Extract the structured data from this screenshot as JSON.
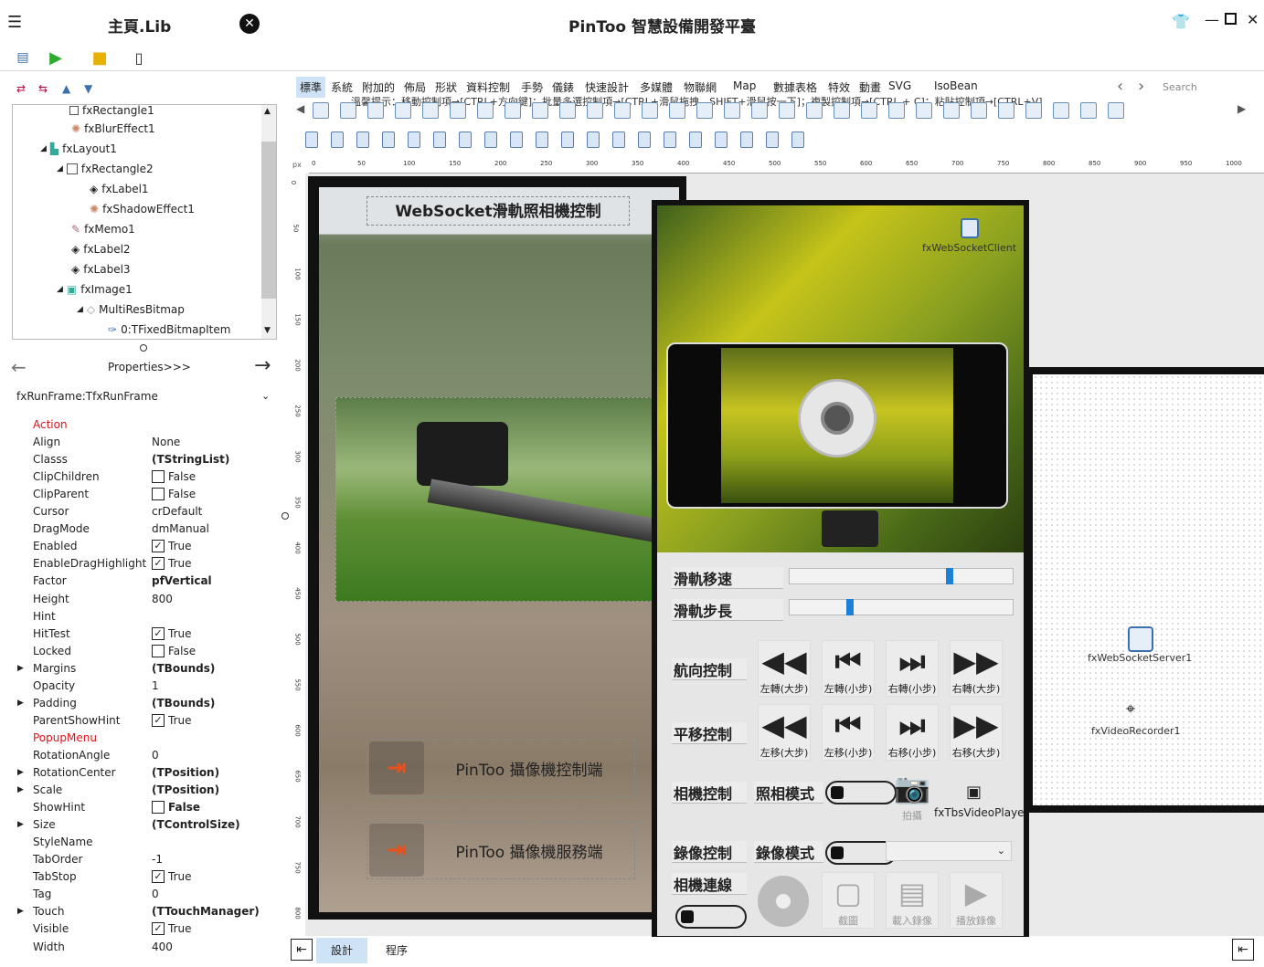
{
  "title": {
    "left": "主頁.Lib",
    "center": "PinToo 智慧設備開發平臺"
  },
  "hint": "溫馨提示：移動控制項→[CTRL+方向鍵]；批量多選控制項→[CTRL+滑鼠拖拽、SHIFT+滑鼠按一下]；複製控制項→[CTRL + C]；粘貼控制項→[CTRL+V]",
  "tree": [
    {
      "label": "fxRectangle1",
      "indent": 1
    },
    {
      "label": "fxBlurEffect1",
      "indent": 2
    },
    {
      "label": "fxLayout1",
      "indent": 1
    },
    {
      "label": "fxRectangle2",
      "indent": 2
    },
    {
      "label": "fxLabel1",
      "indent": 3
    },
    {
      "label": "fxShadowEffect1",
      "indent": 3
    },
    {
      "label": "fxMemo1",
      "indent": 2
    },
    {
      "label": "fxLabel2",
      "indent": 2
    },
    {
      "label": "fxLabel3",
      "indent": 2
    },
    {
      "label": "fxImage1",
      "indent": 2
    },
    {
      "label": "MultiResBitmap",
      "indent": 3
    },
    {
      "label": "0:TFixedBitmapItem",
      "indent": 4
    }
  ],
  "properties_label": "Properties>>>",
  "component_selector": "fxRunFrame:TfxRunFrame",
  "props": [
    {
      "name": "Action",
      "val": "",
      "red": true
    },
    {
      "name": "Align",
      "val": "None"
    },
    {
      "name": "Classs",
      "val": "(TStringList)",
      "bold": true
    },
    {
      "name": "ClipChildren",
      "val": "False",
      "chk": false
    },
    {
      "name": "ClipParent",
      "val": "False",
      "chk": false
    },
    {
      "name": "Cursor",
      "val": "crDefault"
    },
    {
      "name": "DragMode",
      "val": "dmManual"
    },
    {
      "name": "Enabled",
      "val": "True",
      "chk": true
    },
    {
      "name": "EnableDragHighlight",
      "val": "True",
      "chk": true
    },
    {
      "name": "Factor",
      "val": "pfVertical",
      "bold": true
    },
    {
      "name": "Height",
      "val": "800"
    },
    {
      "name": "Hint",
      "val": ""
    },
    {
      "name": "HitTest",
      "val": "True",
      "chk": true
    },
    {
      "name": "Locked",
      "val": "False",
      "chk": false
    },
    {
      "name": "Margins",
      "val": "(TBounds)",
      "bold": true,
      "expand": true
    },
    {
      "name": "Opacity",
      "val": "1"
    },
    {
      "name": "Padding",
      "val": "(TBounds)",
      "bold": true,
      "expand": true
    },
    {
      "name": "ParentShowHint",
      "val": "True",
      "chk": true
    },
    {
      "name": "PopupMenu",
      "val": "",
      "red": true
    },
    {
      "name": "RotationAngle",
      "val": "0"
    },
    {
      "name": "RotationCenter",
      "val": "(TPosition)",
      "bold": true,
      "expand": true
    },
    {
      "name": "Scale",
      "val": "(TPosition)",
      "bold": true,
      "expand": true
    },
    {
      "name": "ShowHint",
      "val": "False",
      "chk": false,
      "bold": true
    },
    {
      "name": "Size",
      "val": "(TControlSize)",
      "bold": true,
      "expand": true
    },
    {
      "name": "StyleName",
      "val": ""
    },
    {
      "name": "TabOrder",
      "val": "-1"
    },
    {
      "name": "TabStop",
      "val": "True",
      "chk": true
    },
    {
      "name": "Tag",
      "val": "0"
    },
    {
      "name": "Touch",
      "val": "(TTouchManager)",
      "bold": true,
      "expand": true
    },
    {
      "name": "Visible",
      "val": "True",
      "chk": true
    },
    {
      "name": "Width",
      "val": "400"
    }
  ],
  "tabs": [
    "標準",
    "系統",
    "附加的",
    "佈局",
    "形狀",
    "資料控制",
    "手勢",
    "儀錶",
    "快速設計",
    "多媒體",
    "物聯網",
    "Map",
    "數據表格",
    "特效",
    "動畫",
    "SVG",
    "IsoBean"
  ],
  "search_placeholder": "Search",
  "ruler_h": [
    "0",
    "50",
    "100",
    "150",
    "200",
    "250",
    "300",
    "350",
    "400",
    "450",
    "500",
    "550",
    "600",
    "650",
    "700",
    "750",
    "800",
    "850",
    "900",
    "950",
    "1000"
  ],
  "ruler_v": [
    "0",
    "50",
    "100",
    "150",
    "200",
    "250",
    "300",
    "350",
    "400",
    "450",
    "500",
    "550",
    "600",
    "650",
    "700",
    "750",
    "800"
  ],
  "ruler_unit": "px",
  "frame1": {
    "title": "WebSocket滑軌照相機控制",
    "btn1": "PinToo 攝像機控制端",
    "btn2": "PinToo 攝像機服務端"
  },
  "frame2": {
    "ws_client": "fxWebSocketClient",
    "speed": "滑軌移速",
    "step": "滑軌步長",
    "speed_value": 0.72,
    "step_value": 0.26,
    "heading": "航向控制",
    "pan": "平移控制",
    "heading_btns": [
      "左轉(大步)",
      "左轉(小步)",
      "右轉(小步)",
      "右轉(大步)"
    ],
    "pan_btns": [
      "左移(大步)",
      "左移(小步)",
      "右移(小步)",
      "右移(大步)"
    ],
    "camera_ctrl": "相機控制",
    "photo_mode": "照相模式",
    "shoot": "拍攝",
    "video_player": "fxTbsVideoPlayer",
    "record_ctrl": "錄像控制",
    "record_mode": "錄像模式",
    "camera_conn": "相機連線",
    "screenshot": "截圖",
    "load_video": "載入錄像",
    "play_video": "播放錄像"
  },
  "frame3": {
    "server": "fxWebSocketServer1",
    "recorder": "fxVideoRecorder1"
  },
  "bottom": {
    "design_tab": "設計",
    "code_tab": "程序"
  }
}
